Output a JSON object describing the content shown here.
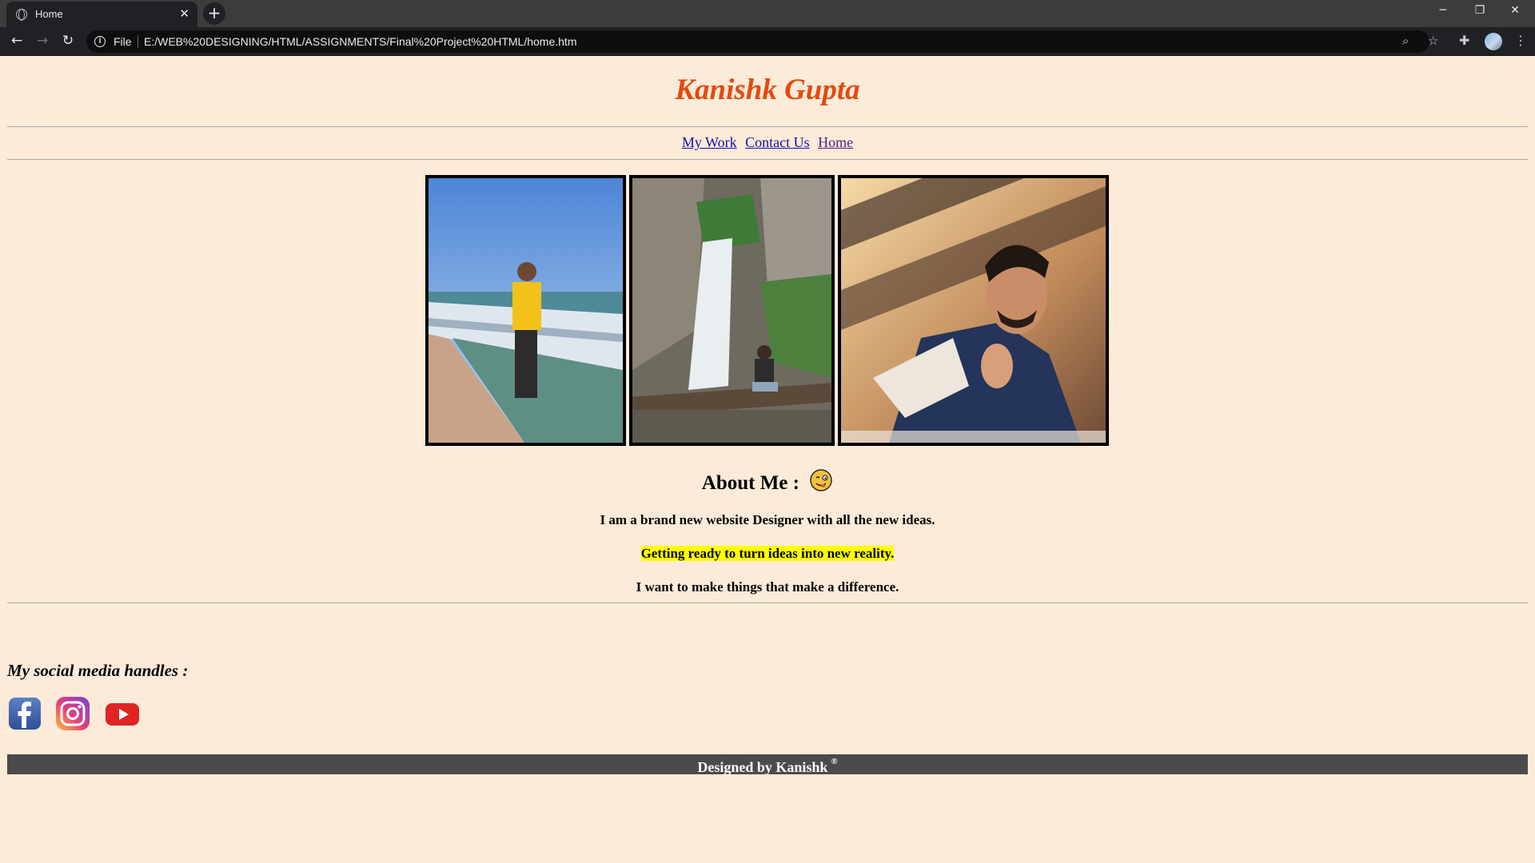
{
  "browser": {
    "tab_title": "Home",
    "scheme_label": "File",
    "url": "E:/WEB%20DESIGNING/HTML/ASSIGNMENTS/Final%20Project%20HTML/home.htm"
  },
  "site": {
    "title": "Kanishk Gupta",
    "nav": [
      {
        "label": "My Work"
      },
      {
        "label": "Contact Us"
      },
      {
        "label": "Home"
      }
    ]
  },
  "about": {
    "heading": "About Me :",
    "line1": "I am a brand new website Designer with all the new ideas.",
    "line2": "Getting ready to turn ideas into new reality.",
    "line3": "I want to make things that make a difference."
  },
  "social": {
    "heading": "My social media handles :",
    "icons": [
      "facebook-icon",
      "instagram-icon",
      "youtube-icon"
    ]
  },
  "footer": {
    "text": "Designed by Kanishk",
    "mark": "®"
  },
  "colors": {
    "page_background": "#fbebd8",
    "title": "#e34a10",
    "highlight": "#ffff00",
    "footer_background": "#4b4b4b"
  }
}
